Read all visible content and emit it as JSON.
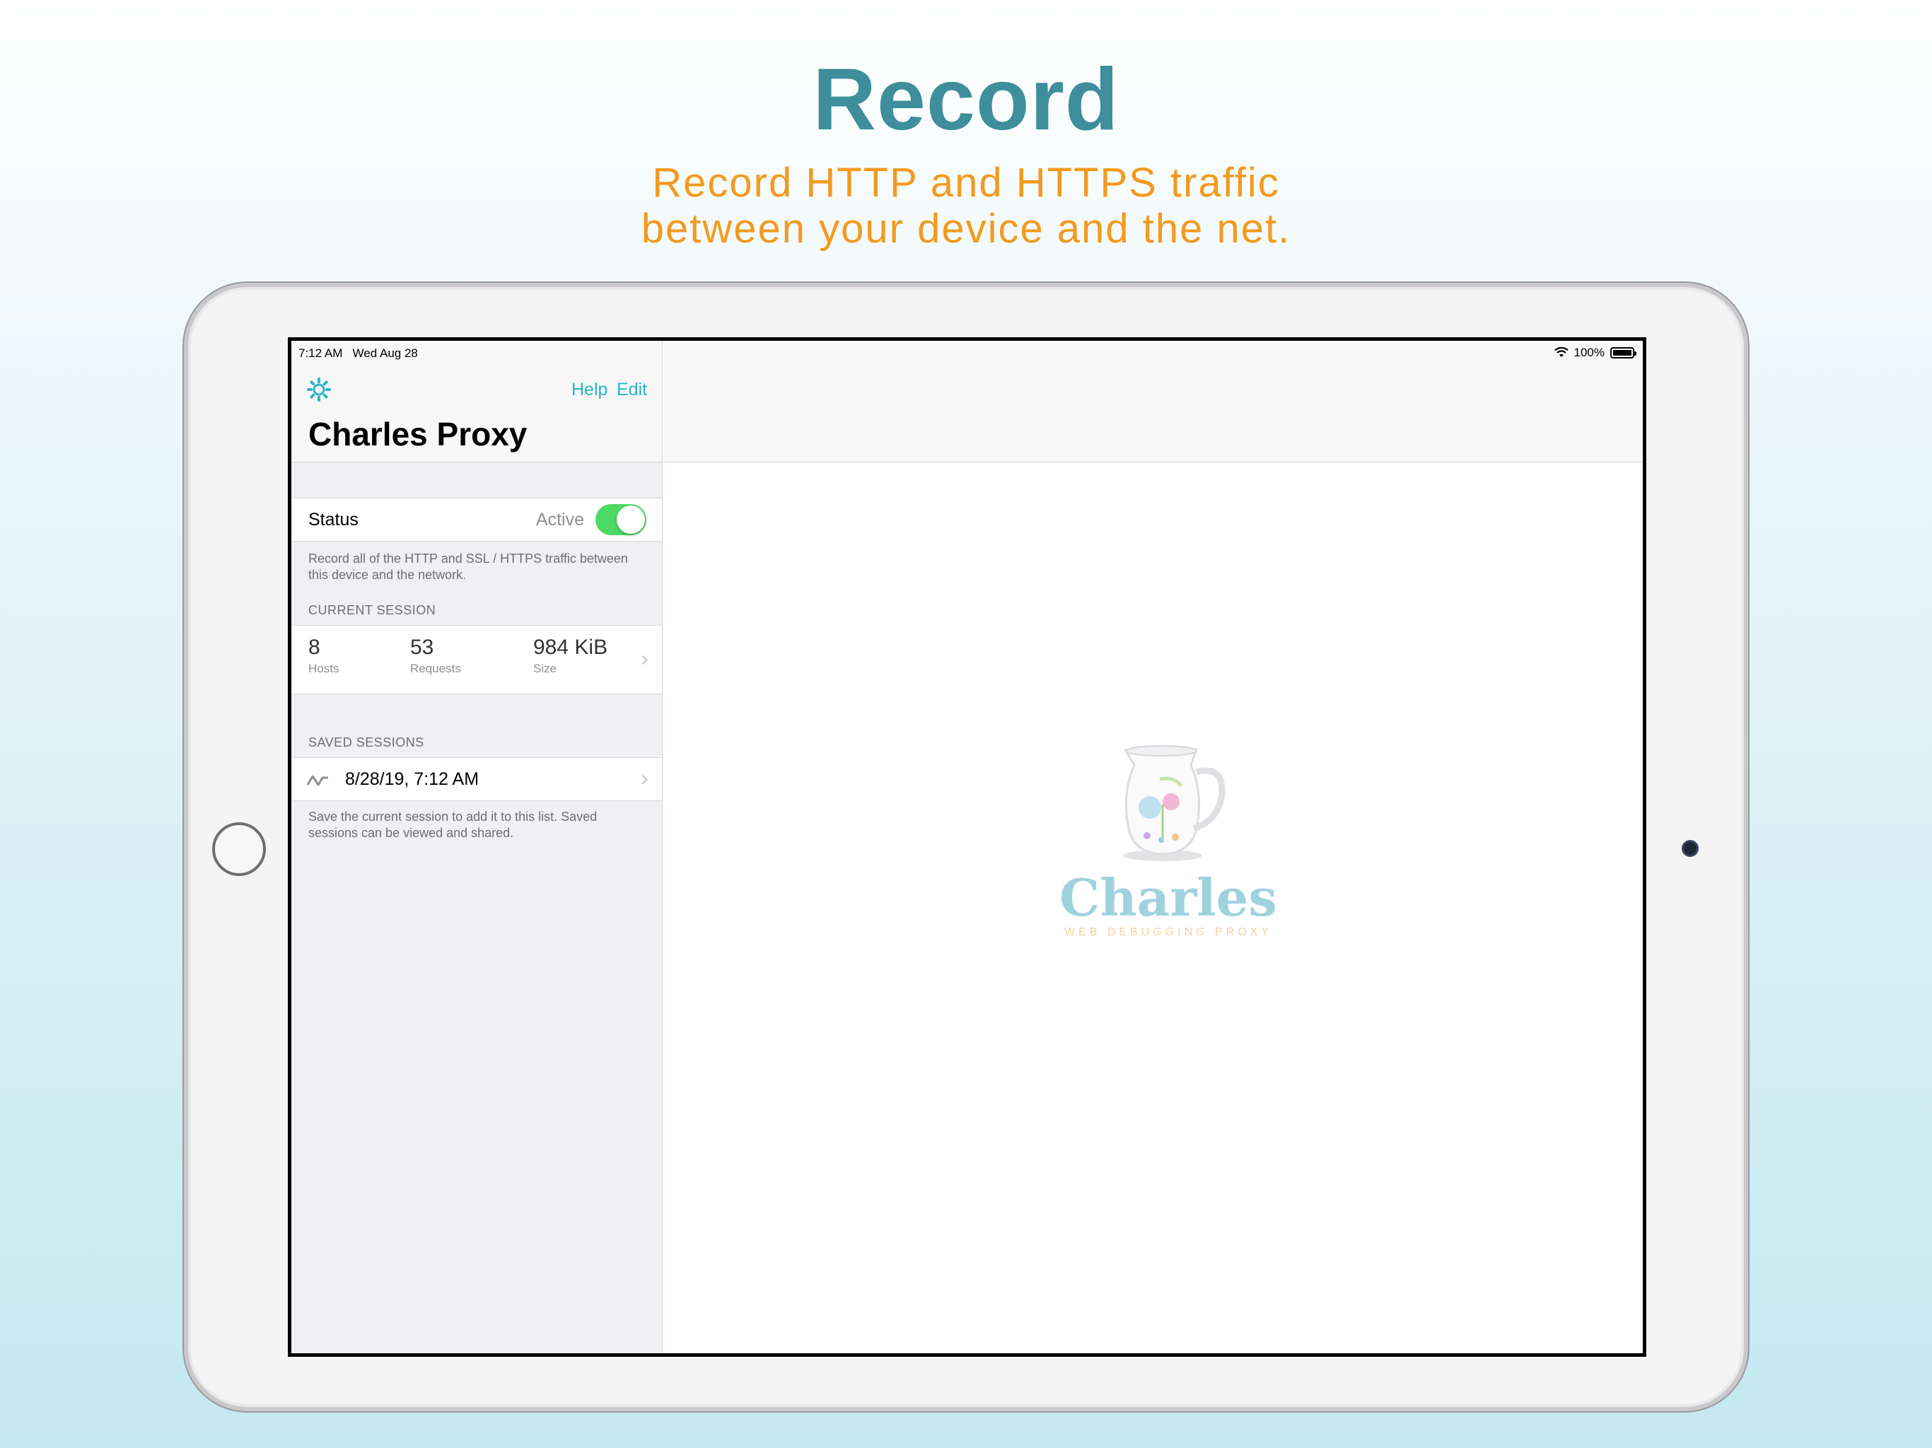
{
  "marketing": {
    "headline": "Record",
    "subline_1": "Record HTTP and HTTPS traffic",
    "subline_2": "between your device and the net."
  },
  "statusbar": {
    "time": "7:12 AM",
    "date": "Wed Aug 28",
    "battery": "100%"
  },
  "nav": {
    "help_label": "Help",
    "edit_label": "Edit",
    "title": "Charles Proxy"
  },
  "status": {
    "label": "Status",
    "value": "Active",
    "toggle_on": true,
    "footnote": "Record all of the HTTP and SSL / HTTPS traffic between this device and the network."
  },
  "current_session": {
    "header": "CURRENT SESSION",
    "hosts_value": "8",
    "hosts_label": "Hosts",
    "requests_value": "53",
    "requests_label": "Requests",
    "size_value": "984 KiB",
    "size_label": "Size"
  },
  "saved_sessions": {
    "header": "SAVED SESSIONS",
    "items": [
      {
        "label": "8/28/19, 7:12 AM"
      }
    ],
    "footnote": "Save the current session to add it to this list. Saved sessions can be viewed and shared."
  },
  "logo": {
    "wordmark": "Charles",
    "tagline": "WEB DEBUGGING PROXY"
  },
  "colors": {
    "accent": "#2ab3c9",
    "headline": "#3e8e9b",
    "subline": "#f39a1e",
    "toggle_on": "#4cd964"
  }
}
